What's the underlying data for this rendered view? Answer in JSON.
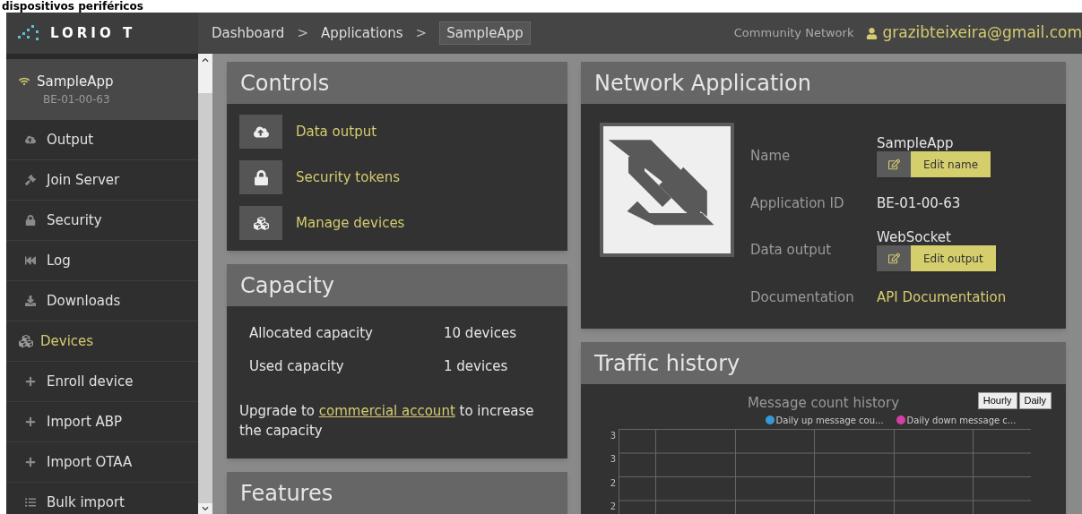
{
  "page_heading": "dispositivos periféricos",
  "logo": "LORIO T",
  "breadcrumbs": [
    {
      "label": "Dashboard",
      "selected": false
    },
    {
      "label": "Applications",
      "selected": false
    },
    {
      "label": "SampleApp",
      "selected": true
    }
  ],
  "breadcrumb_separator": ">",
  "network": "Community Network",
  "user": "grazibteixeira@gmail.com",
  "sidebar": {
    "app": {
      "name": "SampleApp",
      "id": "BE-01-00-63"
    },
    "items": [
      {
        "label": "Output",
        "kind": "link"
      },
      {
        "label": "Join Server",
        "kind": "link"
      },
      {
        "label": "Security",
        "kind": "link"
      },
      {
        "label": "Log",
        "kind": "link"
      },
      {
        "label": "Downloads",
        "kind": "link"
      },
      {
        "label": "Devices",
        "kind": "section"
      },
      {
        "label": "Enroll device",
        "kind": "link"
      },
      {
        "label": "Import ABP",
        "kind": "link"
      },
      {
        "label": "Import OTAA",
        "kind": "link"
      },
      {
        "label": "Bulk import",
        "kind": "link"
      }
    ]
  },
  "controls": {
    "title": "Controls",
    "items": [
      {
        "label": "Data output"
      },
      {
        "label": "Security tokens"
      },
      {
        "label": "Manage devices"
      }
    ]
  },
  "capacity": {
    "title": "Capacity",
    "rows": [
      {
        "label": "Allocated capacity",
        "value": "10 devices"
      },
      {
        "label": "Used capacity",
        "value": "1 devices"
      }
    ],
    "note_before": "Upgrade to",
    "note_link": "commercial account",
    "note_after": "to increase the capacity"
  },
  "features": {
    "title": "Features"
  },
  "network_application": {
    "title": "Network Application",
    "fields": [
      {
        "label": "Name",
        "value": "SampleApp",
        "kind": "editable",
        "button": "Edit name"
      },
      {
        "label": "Application ID",
        "value": "BE-01-00-63",
        "kind": "text"
      },
      {
        "label": "Data output",
        "value": "WebSocket",
        "kind": "editable",
        "button": "Edit output"
      },
      {
        "label": "Documentation",
        "value": "API Documentation",
        "kind": "link"
      }
    ]
  },
  "traffic_history": {
    "title": "Traffic history",
    "buttons": [
      "Hourly",
      "Daily"
    ],
    "chart": {
      "title": "Message count history",
      "legend": [
        {
          "name": "Daily up message cou...",
          "color": "#3498db"
        },
        {
          "name": "Daily down message c...",
          "color": "#d63fa5"
        }
      ],
      "y_labels": [
        "3",
        "3",
        "2",
        "2"
      ]
    }
  }
}
